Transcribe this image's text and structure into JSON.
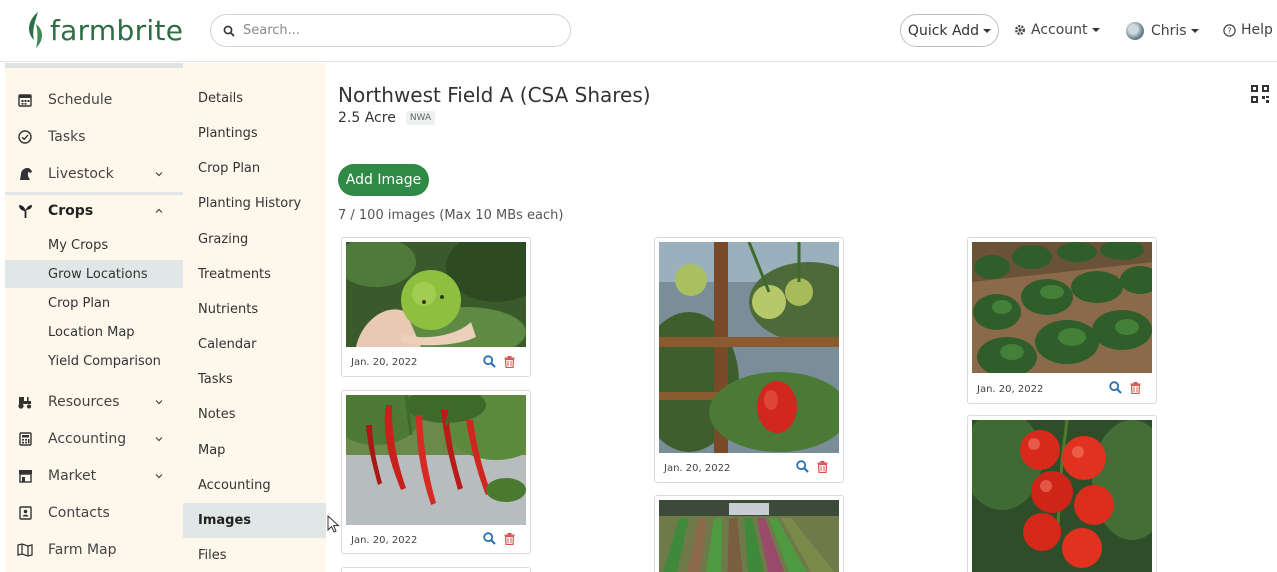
{
  "brand": {
    "name": "farmbrite",
    "color": "#2d6e44"
  },
  "header": {
    "search_placeholder": "Search...",
    "quick_add": "Quick Add",
    "account": "Account",
    "user": "Chris",
    "help": "Help"
  },
  "nav": {
    "items": [
      {
        "label": "Schedule",
        "icon": "calendar-icon"
      },
      {
        "label": "Tasks",
        "icon": "check-circle-icon"
      },
      {
        "label": "Livestock",
        "icon": "horse-icon"
      },
      {
        "label": "Crops",
        "icon": "sprout-icon"
      },
      {
        "label": "Resources",
        "icon": "tractor-icon"
      },
      {
        "label": "Accounting",
        "icon": "calculator-icon"
      },
      {
        "label": "Market",
        "icon": "store-icon"
      },
      {
        "label": "Contacts",
        "icon": "contact-card-icon"
      },
      {
        "label": "Farm Map",
        "icon": "map-icon"
      }
    ],
    "crops_sub": [
      "My Crops",
      "Grow Locations",
      "Crop Plan",
      "Location Map",
      "Yield Comparison"
    ]
  },
  "subnav": [
    "Details",
    "Plantings",
    "Crop Plan",
    "Planting History",
    "Grazing",
    "Treatments",
    "Nutrients",
    "Calendar",
    "Tasks",
    "Notes",
    "Map",
    "Accounting",
    "Images",
    "Files"
  ],
  "location": {
    "title": "Northwest Field A (CSA Shares)",
    "size": "2.5 Acre",
    "tag": "NWA"
  },
  "images": {
    "add_label": "Add Image",
    "count_text": "7 / 100 images (Max 10 MBs each)",
    "items": [
      {
        "date": "Jan. 20, 2022",
        "subject": "green tomato in hand"
      },
      {
        "date": "Jan. 20, 2022",
        "subject": "red chili peppers"
      },
      {
        "date": "Jan. 20, 2022",
        "subject": "tomatoes on trellis"
      },
      {
        "date": "",
        "subject": "crop rows field"
      },
      {
        "date": "Jan. 20, 2022",
        "subject": "leafy greens rows"
      },
      {
        "date": "",
        "subject": "red tomato cluster"
      }
    ]
  },
  "colors": {
    "accent": "#2e8a44",
    "nav_bg": "#fef8ec",
    "selected_bg": "#e1e6e6",
    "link_blue": "#2a6fb0",
    "trash_red": "#d9534f"
  }
}
